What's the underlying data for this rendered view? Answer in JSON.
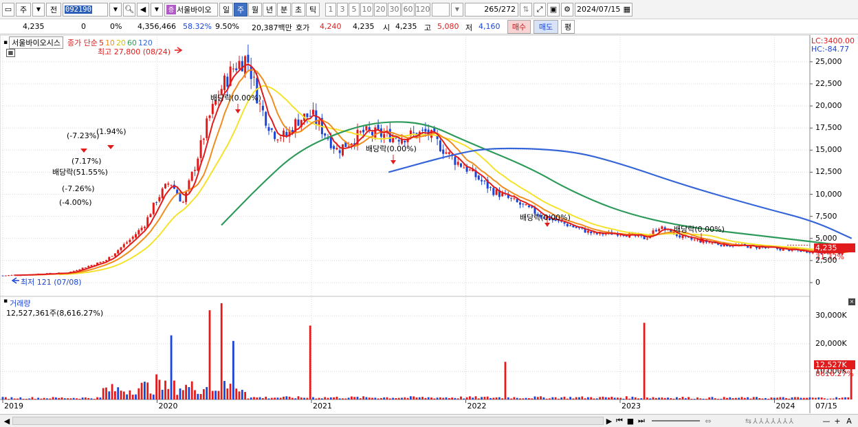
{
  "toolbar": {
    "type_label": "주",
    "prev_label": "전",
    "code": "092190",
    "badge": "증",
    "name": "서울바이오",
    "periods": [
      "일",
      "주",
      "월",
      "년",
      "분",
      "초",
      "틱"
    ],
    "selected_period": "주",
    "intervals": [
      "1",
      "3",
      "5",
      "10",
      "20",
      "30",
      "60",
      "120"
    ],
    "page_current": "265",
    "page_total": "/272",
    "date": "2024/07/15"
  },
  "quote": {
    "price": "4,235",
    "change": "0",
    "change_pct": "0%",
    "volume": "4,356,466",
    "vol_ratio": "58.32%",
    "turnover": "9.50%",
    "amount": "20,387백만",
    "hoga_label": "호가",
    "hoga_value": "4,240",
    "hoga_value2": "4,235",
    "open_label": "시",
    "open_value": "4,235",
    "high_label": "고",
    "high_value": "5,080",
    "low_label": "저",
    "low_value": "4,160",
    "buy_label": "매수",
    "sell_label": "매도",
    "eval_label": "평"
  },
  "price_panel": {
    "stock_name": "서울바이오시스",
    "ma_legend": {
      "prefix": "종가 단순",
      "periods": [
        "5",
        "10",
        "20",
        "60",
        "120"
      ]
    },
    "max_label": "최고 27,800 (08/24)",
    "min_label": "최저 121 (07/08)",
    "lc": "LC:3400.00",
    "hc": "HC:-84.77",
    "current_price_tag": "4,235",
    "current_pct_tag": "31.32%",
    "y_ticks": [
      "25,000",
      "22,500",
      "20,000",
      "17,500",
      "15,000",
      "12,500",
      "10,000",
      "7,500",
      "5,000",
      "2,500",
      "0"
    ],
    "dividend_label": "배당락(0.00%)",
    "early_annotations": [
      "(-7.23%)",
      "(1.94%)",
      "(7.17%)",
      "배당락(51.55%)",
      "(-7.26%)",
      "(-4.00%)"
    ]
  },
  "volume_panel": {
    "title": "거래량",
    "value_label": "12,527,361주(8,616.27%)",
    "y_ticks": [
      "30,000K",
      "20,000K",
      "10,000K"
    ],
    "current_tag": "12,527K",
    "current_pct": "8616.27%"
  },
  "x_axis": {
    "labels": [
      "2019",
      "2020",
      "2021",
      "2022",
      "2023",
      "2024"
    ],
    "last_label": "07/15"
  },
  "colors": {
    "up": "#e11b1b",
    "down": "#1b45d6",
    "ma5": "#e11b1b",
    "ma10": "#f08c1e",
    "ma20": "#f5e22a",
    "ma60": "#2e9a5a",
    "ma120": "#3565d8"
  },
  "chart_data": {
    "type": "candlestick",
    "interval": "weekly",
    "ylim_price": [
      0,
      26000
    ],
    "ylim_volume": [
      0,
      35000000
    ],
    "annual_marks": [
      "2019",
      "2020",
      "2021",
      "2022",
      "2023",
      "2024"
    ],
    "price_path": [
      [
        "2019-01",
        800
      ],
      [
        "2019-06",
        1100
      ],
      [
        "2019-09",
        2500
      ],
      [
        "2019-11",
        5000
      ],
      [
        "2019-12",
        6500
      ],
      [
        "2020-01",
        9500
      ],
      [
        "2020-02",
        11500
      ],
      [
        "2020-03",
        9000
      ],
      [
        "2020-04",
        13500
      ],
      [
        "2020-05",
        18500
      ],
      [
        "2020-06",
        22000
      ],
      [
        "2020-07",
        24500
      ],
      [
        "2020-08",
        25500
      ],
      [
        "2020-09",
        20000
      ],
      [
        "2020-10",
        17000
      ],
      [
        "2020-11",
        16500
      ],
      [
        "2020-12",
        18500
      ],
      [
        "2021-01",
        19000
      ],
      [
        "2021-03",
        15000
      ],
      [
        "2021-05",
        17000
      ],
      [
        "2021-08",
        16500
      ],
      [
        "2021-10",
        17000
      ],
      [
        "2021-12",
        14000
      ],
      [
        "2022-01",
        13000
      ],
      [
        "2022-03",
        10500
      ],
      [
        "2022-05",
        9000
      ],
      [
        "2022-07",
        7500
      ],
      [
        "2022-09",
        6500
      ],
      [
        "2022-11",
        5500
      ],
      [
        "2023-01",
        5600
      ],
      [
        "2023-03",
        5000
      ],
      [
        "2023-04",
        6300
      ],
      [
        "2023-06",
        5000
      ],
      [
        "2023-09",
        4300
      ],
      [
        "2023-12",
        4000
      ],
      [
        "2024-03",
        3600
      ],
      [
        "2024-06",
        3300
      ],
      [
        "2024-07",
        4235
      ]
    ],
    "ma60_path": [
      [
        "2020-06",
        6500
      ],
      [
        "2020-09",
        11000
      ],
      [
        "2020-12",
        15000
      ],
      [
        "2021-04",
        17500
      ],
      [
        "2021-07",
        18300
      ],
      [
        "2021-10",
        18000
      ],
      [
        "2022-01",
        16000
      ],
      [
        "2022-06",
        13000
      ],
      [
        "2022-09",
        10500
      ],
      [
        "2023-01",
        8000
      ],
      [
        "2023-06",
        6300
      ],
      [
        "2023-12",
        5300
      ],
      [
        "2024-07",
        4100
      ]
    ],
    "ma120_path": [
      [
        "2021-07",
        12500
      ],
      [
        "2021-12",
        14500
      ],
      [
        "2022-03",
        15300
      ],
      [
        "2022-09",
        15000
      ],
      [
        "2023-01",
        13500
      ],
      [
        "2023-06",
        11000
      ],
      [
        "2023-12",
        8500
      ],
      [
        "2024-04",
        7000
      ],
      [
        "2024-07",
        5000
      ]
    ],
    "volume_spikes": [
      [
        "2020-01",
        9000000
      ],
      [
        "2020-02",
        23000000
      ],
      [
        "2020-05",
        32000000
      ],
      [
        "2020-06",
        34500000
      ],
      [
        "2020-07",
        21000000
      ],
      [
        "2021-01",
        26500000
      ],
      [
        "2022-04",
        13500000
      ],
      [
        "2023-03",
        27500000
      ],
      [
        "2024-07",
        12527361
      ]
    ]
  }
}
